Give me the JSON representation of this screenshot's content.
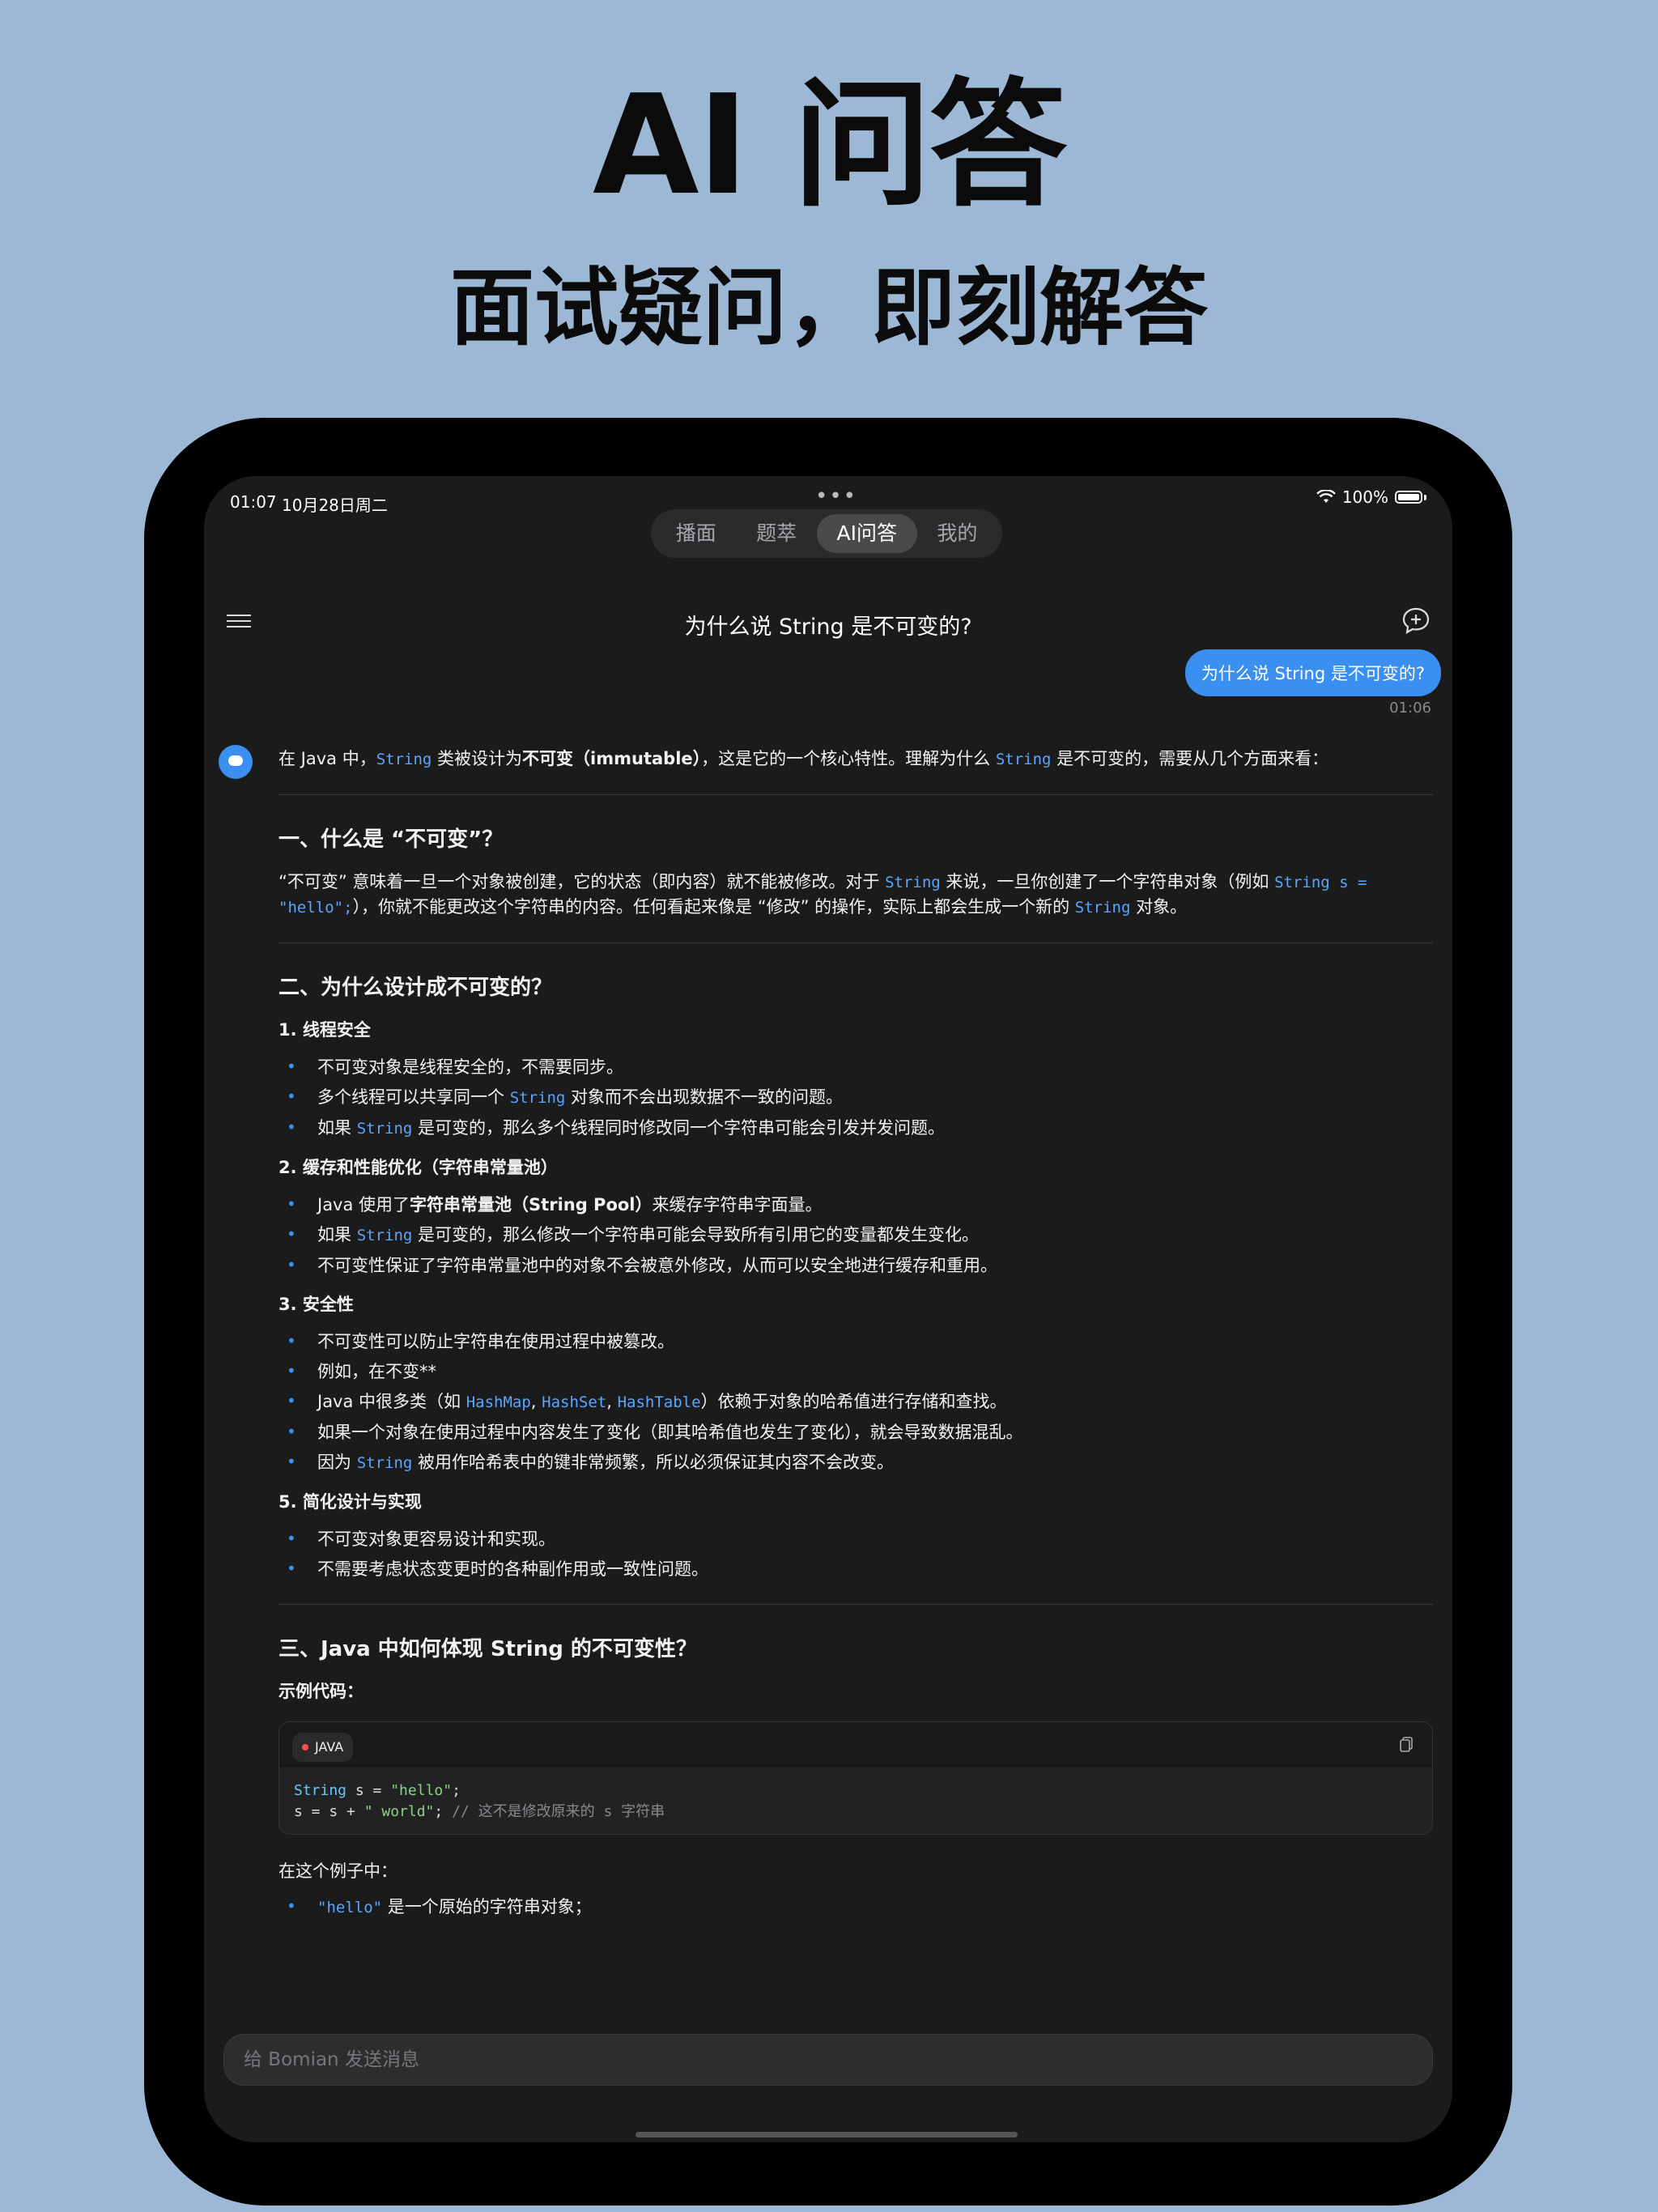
{
  "hero": {
    "title": "AI 问答",
    "subtitle": "面试疑问，即刻解答"
  },
  "status_bar": {
    "time": "01:07",
    "date": "10月28日周二",
    "dots": "•••",
    "battery": "100%"
  },
  "tabs": [
    {
      "label": "播面",
      "active": false
    },
    {
      "label": "题萃",
      "active": false
    },
    {
      "label": "AI问答",
      "active": true
    },
    {
      "label": "我的",
      "active": false
    }
  ],
  "header": {
    "title": "为什么说 String 是不可变的?"
  },
  "user_message": {
    "text": "为什么说 String 是不可变的?",
    "time": "01:06"
  },
  "answer": {
    "intro": [
      "在 Java 中，",
      "String",
      " 类被设计为",
      "不可变（immutable）",
      "，这是它的一个核心特性。理解为什么 ",
      "String",
      " 是不可变的，需要从几个方面来看："
    ],
    "section1_title": "一、什么是 “不可变”？",
    "section1_body": [
      "“不可变” 意味着一旦一个对象被创建，它的状态（即内容）就不能被修改。对于 ",
      "String",
      " 来说，一旦你创建了一个字符串对象（例如 ",
      "String s = \"hello\";",
      "），你就不能更改这个字符串的内容。任何看起来像是 “修改” 的操作，实际上都会生成一个新的 ",
      "String",
      " 对象。"
    ],
    "section2_title": "二、为什么设计成不可变的？",
    "sub1_title": "1. 线程安全",
    "sub1_items": [
      [
        "不可变对象是线程安全的，不需要同步。"
      ],
      [
        "多个线程可以共享同一个 ",
        "String",
        " 对象而不会出现数据不一致的问题。"
      ],
      [
        "如果 ",
        "String",
        " 是可变的，那么多个线程同时修改同一个字符串可能会引发并发问题。"
      ]
    ],
    "sub2_title": "2. 缓存和性能优化（字符串常量池）",
    "sub2_items": [
      [
        "Java 使用了",
        "字符串常量池（String Pool）",
        "来缓存字符串字面量。"
      ],
      [
        "如果 ",
        "String",
        " 是可变的，那么修改一个字符串可能会导致所有引用它的变量都发生变化。"
      ],
      [
        "不可变性保证了字符串常量池中的对象不会被意外修改，从而可以安全地进行缓存和重用。"
      ]
    ],
    "sub3_title": "3. 安全性",
    "sub3_items": [
      [
        "不可变性可以防止字符串在使用过程中被篡改。"
      ],
      [
        "例如，在不变**"
      ],
      [
        "Java 中很多类（如 ",
        "HashMap",
        ", ",
        "HashSet",
        ", ",
        "HashTable",
        "）依赖于对象的哈希值进行存储和查找。"
      ],
      [
        "如果一个对象在使用过程中内容发生了变化（即其哈希值也发生了变化），就会导致数据混乱。"
      ],
      [
        "因为 ",
        "String",
        " 被用作哈希表中的键非常频繁，所以必须保证其内容不会改变。"
      ]
    ],
    "sub5_title": "5. 简化设计与实现",
    "sub5_items": [
      [
        "不可变对象更容易设计和实现。"
      ],
      [
        "不需要考虑状态变更时的各种副作用或一致性问题。"
      ]
    ],
    "section3_title": "三、Java 中如何体现 String 的不可变性？",
    "example_label": "示例代码：",
    "code": {
      "lang": "JAVA",
      "line1": [
        "String",
        " s = ",
        "\"hello\"",
        ";"
      ],
      "line2": [
        "s = s + ",
        "\" world\"",
        "; ",
        "// 这不是修改原来的 s 字符串"
      ]
    },
    "after_code": "在这个例子中：",
    "tail_item": [
      "\"hello\"",
      " 是一个原始的字符串对象；"
    ]
  },
  "input": {
    "placeholder": "给 Bomian 发送消息"
  },
  "colors": {
    "background": "#9db8d5",
    "accent": "#3b8ff0",
    "screen": "#1b1b1c"
  }
}
